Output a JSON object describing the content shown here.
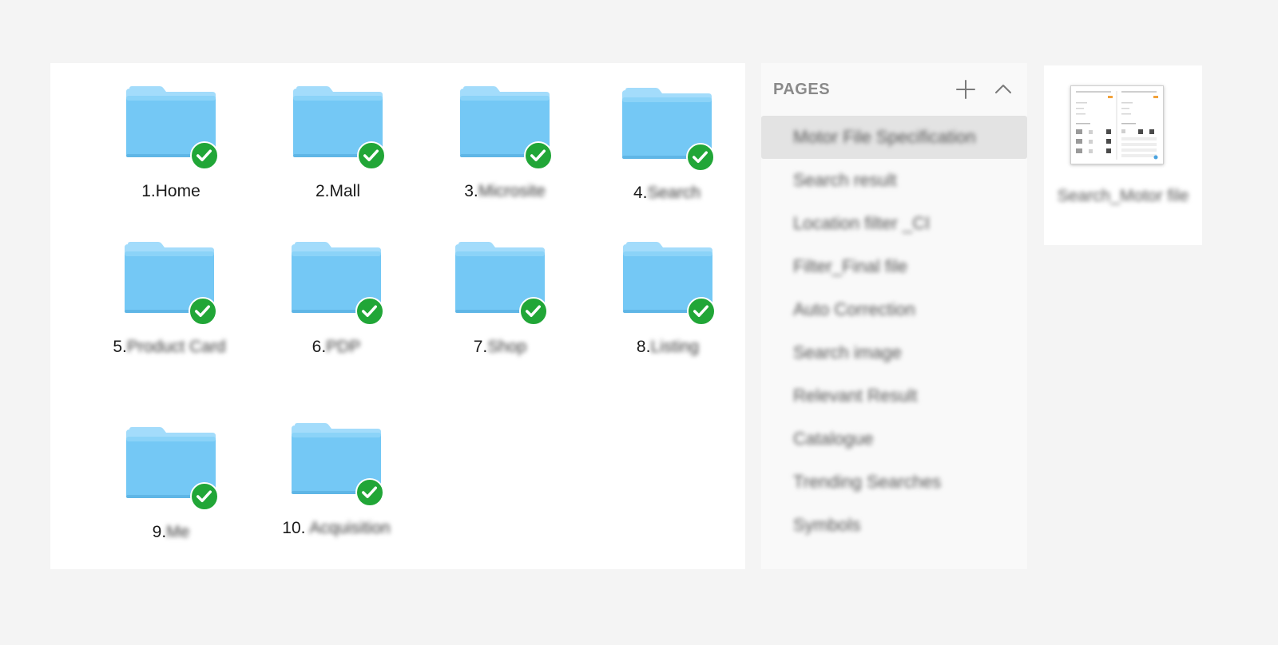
{
  "folders": [
    {
      "number": "1.",
      "name": "Home"
    },
    {
      "number": "2.",
      "name": "Mall"
    },
    {
      "number": "3.",
      "name": "Microsite"
    },
    {
      "number": "4.",
      "name": "Search"
    },
    {
      "number": "5.",
      "name": "Product Card"
    },
    {
      "number": "6.",
      "name": "PDP"
    },
    {
      "number": "7.",
      "name": "Shop"
    },
    {
      "number": "8.",
      "name": "Listing"
    },
    {
      "number": "9.",
      "name": "Me"
    },
    {
      "number": "10. ",
      "name": "Acquisition"
    }
  ],
  "pages_panel": {
    "title": "PAGES",
    "add_icon": "plus-icon",
    "collapse_icon": "chevron-up-icon",
    "items": [
      {
        "label": "Motor File Specification",
        "selected": true
      },
      {
        "label": "Search result"
      },
      {
        "label": "Location filter _CI"
      },
      {
        "label": "Filter_Final file"
      },
      {
        "label": "Auto Correction"
      },
      {
        "label": "Search image"
      },
      {
        "label": "Relevant Result"
      },
      {
        "label": "Catalogue"
      },
      {
        "label": "Trending Searches"
      },
      {
        "label": "Symbols"
      }
    ]
  },
  "thumbnail": {
    "label": "Search_Motor file"
  },
  "colors": {
    "folder_body": "#74c8f5",
    "folder_tab": "#9ad9fb",
    "check_badge": "#21a637",
    "selected_row": "#e3e3e3"
  }
}
